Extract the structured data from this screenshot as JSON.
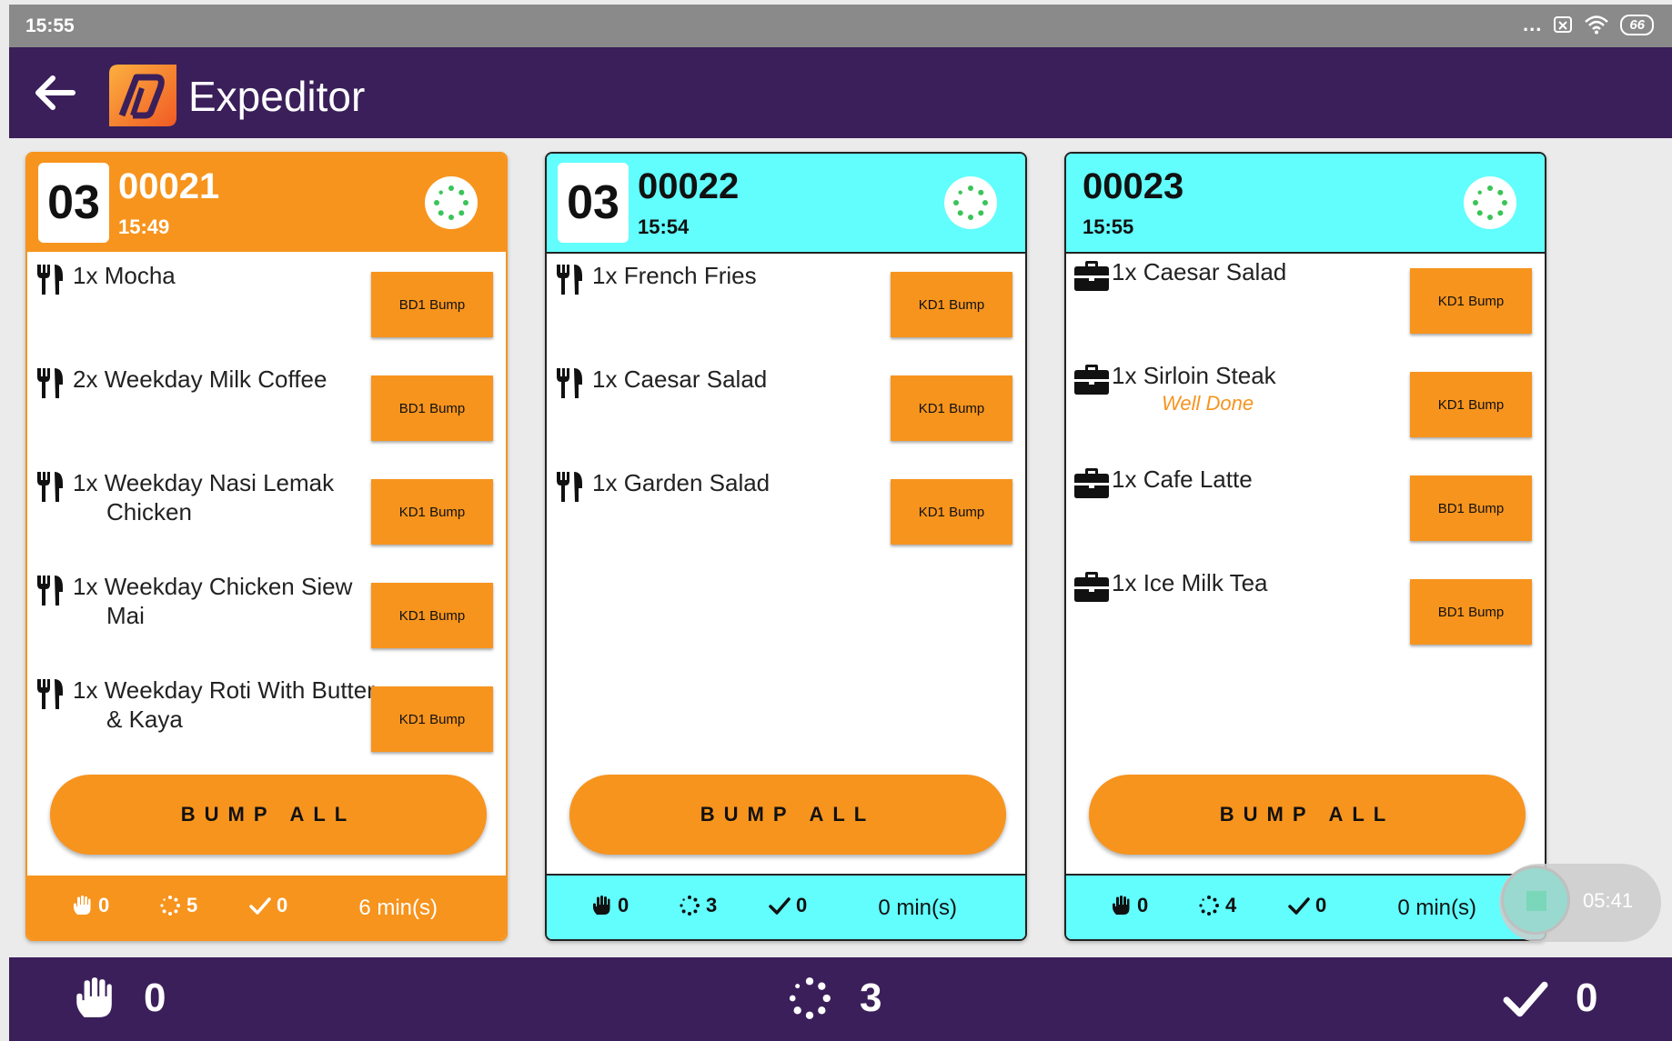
{
  "status_bar": {
    "time": "15:55",
    "menu_dots": "...",
    "battery": "66"
  },
  "app": {
    "title": "Expeditor"
  },
  "colors": {
    "accent": "#f7941d",
    "header_bg": "#3b1f5a",
    "cyan": "#62fdfd",
    "status_green": "#3ac458"
  },
  "tickets": [
    {
      "table": "03",
      "order": "00021",
      "time": "15:49",
      "items": [
        {
          "qty": "1x",
          "name": "Mocha",
          "bump": "BD1 Bump"
        },
        {
          "qty": "2x",
          "name": "Weekday Milk Coffee",
          "bump": "BD1 Bump"
        },
        {
          "qty": "1x",
          "name": "Weekday Nasi Lemak Chicken",
          "bump": "KD1 Bump"
        },
        {
          "qty": "1x",
          "name": "Weekday Chicken Siew Mai",
          "bump": "KD1 Bump"
        },
        {
          "qty": "1x",
          "name": "Weekday Roti With Butter & Kaya",
          "bump": "KD1 Bump"
        }
      ],
      "bump_all": "BUMP ALL",
      "footer": {
        "hold": "0",
        "pending": "5",
        "done": "0",
        "mins": "6 min(s)"
      }
    },
    {
      "table": "03",
      "order": "00022",
      "time": "15:54",
      "items": [
        {
          "qty": "1x",
          "name": "French Fries",
          "bump": "KD1 Bump"
        },
        {
          "qty": "1x",
          "name": "Caesar Salad",
          "bump": "KD1 Bump"
        },
        {
          "qty": "1x",
          "name": "Garden Salad",
          "bump": "KD1 Bump"
        }
      ],
      "bump_all": "BUMP ALL",
      "footer": {
        "hold": "0",
        "pending": "3",
        "done": "0",
        "mins": "0 min(s)"
      }
    },
    {
      "table": "",
      "order": "00023",
      "time": "15:55",
      "items": [
        {
          "qty": "1x",
          "name": "Caesar Salad",
          "bump": "KD1 Bump"
        },
        {
          "qty": "1x",
          "name": "Sirloin Steak",
          "note": "Well Done",
          "bump": "KD1 Bump"
        },
        {
          "qty": "1x",
          "name": "Cafe Latte",
          "bump": "BD1 Bump"
        },
        {
          "qty": "1x",
          "name": "Ice Milk Tea",
          "bump": "BD1 Bump"
        }
      ],
      "bump_all": "BUMP ALL",
      "footer": {
        "hold": "0",
        "pending": "4",
        "done": "0",
        "mins": "0 min(s)"
      }
    }
  ],
  "timer": {
    "value": "05:41"
  },
  "bottom_bar": {
    "hold": "0",
    "pending": "3",
    "done": "0"
  }
}
